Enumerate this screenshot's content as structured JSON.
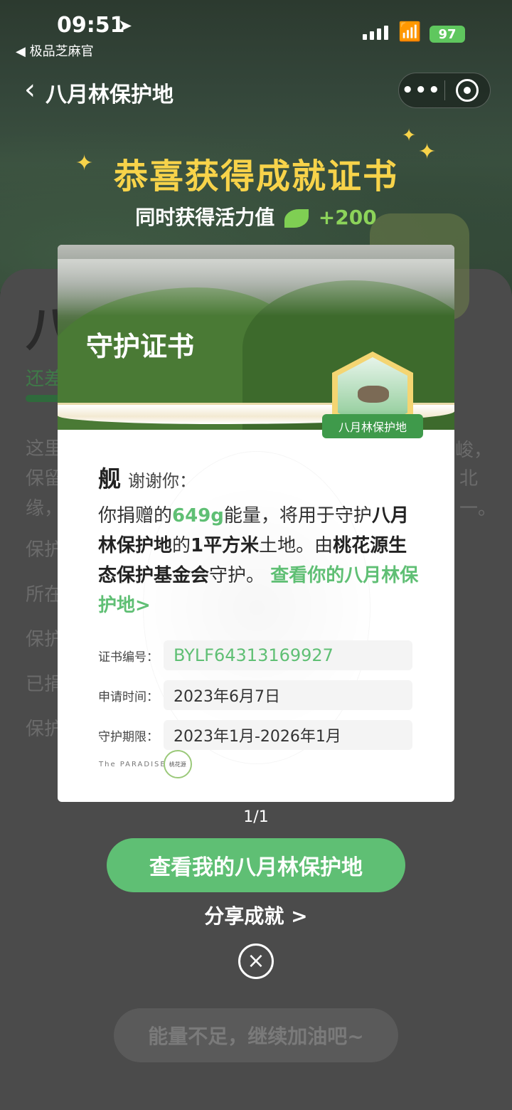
{
  "status": {
    "time": "09:51",
    "back_app": "◀ 极品芝麻官",
    "battery": "97"
  },
  "nav": {
    "title": "八月林保护地",
    "more": "•••"
  },
  "header": {
    "congrats": "恭喜获得成就证书",
    "sub_prefix": "同时获得活力值",
    "sub_value": "+200"
  },
  "background": {
    "big_title": "八",
    "green_text": "还差",
    "lines": [
      "这里",
      "保留",
      "缘，",
      "保护",
      "所在",
      "保护",
      "已捐",
      "保护"
    ],
    "right_marks": [
      "峻，",
      "北",
      "一。"
    ],
    "bottom_button": "能量不足，继续加油吧~"
  },
  "certificate": {
    "title": "守护证书",
    "badge_label": "八月林保护地",
    "name": "舰",
    "thanks": "谢谢你：",
    "body": {
      "p1": "你捐赠的",
      "energy": "649g",
      "p2": "能量，将用于守护",
      "area_name": "八月林保护地",
      "p3": "的",
      "area_size": "1平方米",
      "p4": "土地。由",
      "foundation": "桃花源生态保护基金会",
      "p5": "守护。",
      "link": "查看你的八月林保护地>"
    },
    "fields": [
      {
        "label": "证书编号：",
        "value": "BYLF64313169927"
      },
      {
        "label": "申请时间：",
        "value": "2023年6月7日"
      },
      {
        "label": "守护期限：",
        "value": "2023年1月-2026年1月"
      }
    ],
    "logo_text": "The PARADISE",
    "logo_cn": "桃花源"
  },
  "pager": "1/1",
  "primary_button": "查看我的八月林保护地",
  "share": "分享成就 >",
  "close_icon": "×"
}
